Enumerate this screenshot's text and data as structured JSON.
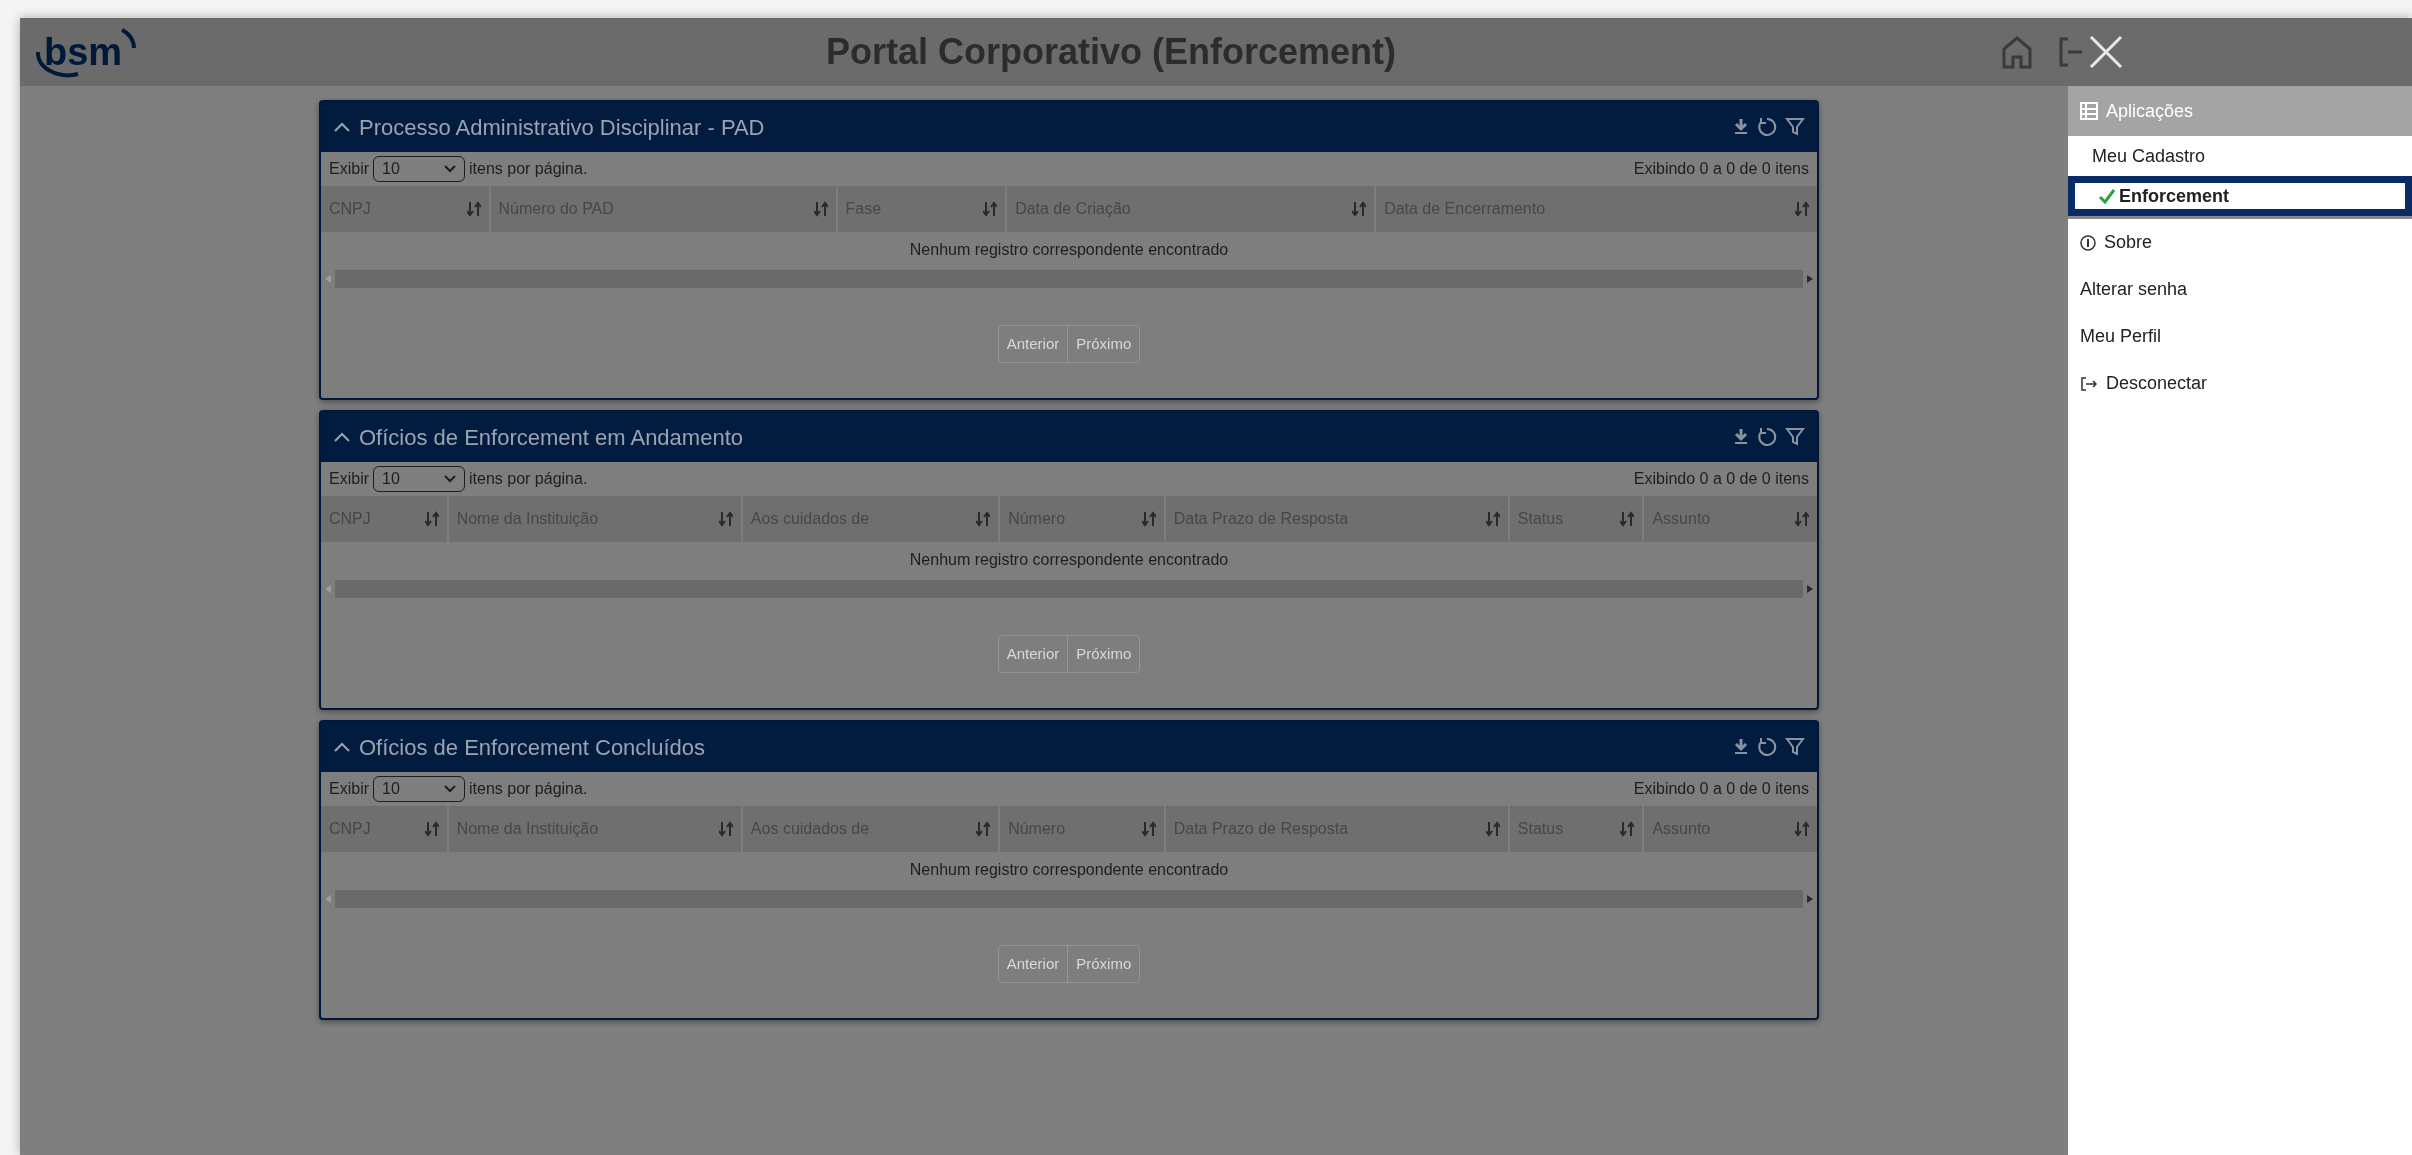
{
  "header": {
    "logo_text": "bsm",
    "title": "Portal Corporativo (Enforcement)"
  },
  "menu": {
    "section": {
      "label": "Aplicações",
      "children": [
        {
          "label": "Meu Cadastro",
          "selected": false
        },
        {
          "label": "Enforcement",
          "selected": true
        }
      ]
    },
    "items": [
      {
        "label": "Sobre",
        "kind": "info"
      },
      {
        "label": "Alterar senha",
        "kind": "plain"
      },
      {
        "label": "Meu Perfil",
        "kind": "plain"
      },
      {
        "label": "Desconectar",
        "kind": "logout"
      }
    ]
  },
  "panels": [
    {
      "title": "Processo Administrativo Disciplinar - PAD",
      "show_label": "Exibir",
      "page_size": "10",
      "per_page": "itens por página.",
      "summary": "Exibindo 0 a 0 de 0 itens",
      "columns": [
        "CNPJ",
        "Número do PAD",
        "Fase",
        "Data de Criação",
        "Data de Encerramento"
      ],
      "empty": "Nenhum registro correspondente encontrado",
      "buttons": [
        {
          "label": "Anterior",
          "disabled": true
        },
        {
          "label": "Próximo",
          "disabled": true
        }
      ]
    },
    {
      "title": "Ofícios de Enforcement em Andamento",
      "show_label": "Exibir",
      "page_size": "10",
      "per_page": "itens por página.",
      "summary": "Exibindo 0 a 0 de 0 itens",
      "columns": [
        "CNPJ",
        "Nome da Instituição",
        "Aos cuidados de",
        "Número",
        "Data Prazo de Resposta",
        "Status",
        "Assunto"
      ],
      "empty": "Nenhum registro correspondente encontrado",
      "buttons": [
        {
          "label": "Anterior",
          "disabled": true
        },
        {
          "label": "Próximo",
          "disabled": true
        }
      ]
    },
    {
      "title": "Ofícios de Enforcement Concluídos",
      "show_label": "Exibir",
      "page_size": "10",
      "per_page": "itens por página.",
      "summary": "Exibindo 0 a 0 de 0 itens",
      "columns": [
        "CNPJ",
        "Nome da Instituição",
        "Aos cuidados de",
        "Número",
        "Data Prazo de Resposta",
        "Status",
        "Assunto"
      ],
      "empty": "Nenhum registro correspondente encontrado",
      "buttons": [
        {
          "label": "Anterior",
          "disabled": true
        },
        {
          "label": "Próximo",
          "disabled": true
        }
      ]
    }
  ]
}
